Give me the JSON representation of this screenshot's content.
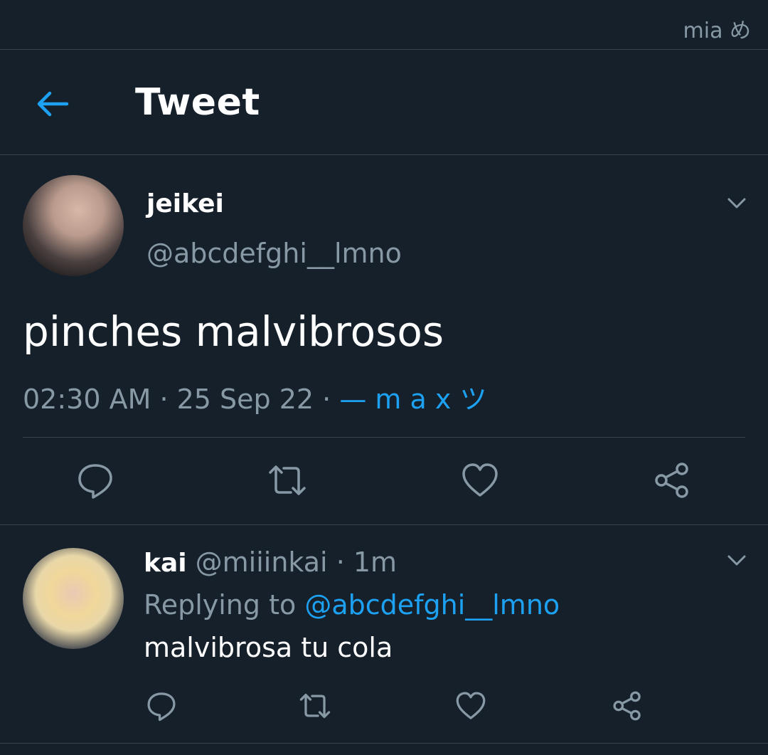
{
  "statusbar": {
    "text": "mia め"
  },
  "header": {
    "title": "Tweet",
    "back_icon": "arrow-left-icon"
  },
  "main_tweet": {
    "display_name": "jeikei",
    "handle": "@abcdefghi__lmno",
    "text": "pinches malvibrosos",
    "timestamp": "02:30 AM · 25 Sep 22 · ",
    "source": "— m a x ツ",
    "actions": [
      "reply-icon",
      "retweet-icon",
      "like-icon",
      "share-icon"
    ]
  },
  "reply_tweet": {
    "display_name": "kai",
    "handle_time": " @miiinkai · 1m",
    "replying_prefix": "Replying to ",
    "replying_to": "@abcdefghi__lmno",
    "text": "malvibrosa tu cola",
    "actions": [
      "reply-icon",
      "retweet-icon",
      "like-icon",
      "share-icon"
    ]
  },
  "colors": {
    "background": "#15202b",
    "accent": "#1da1f2",
    "secondary_text": "#8899a6",
    "divider": "#38444d"
  }
}
